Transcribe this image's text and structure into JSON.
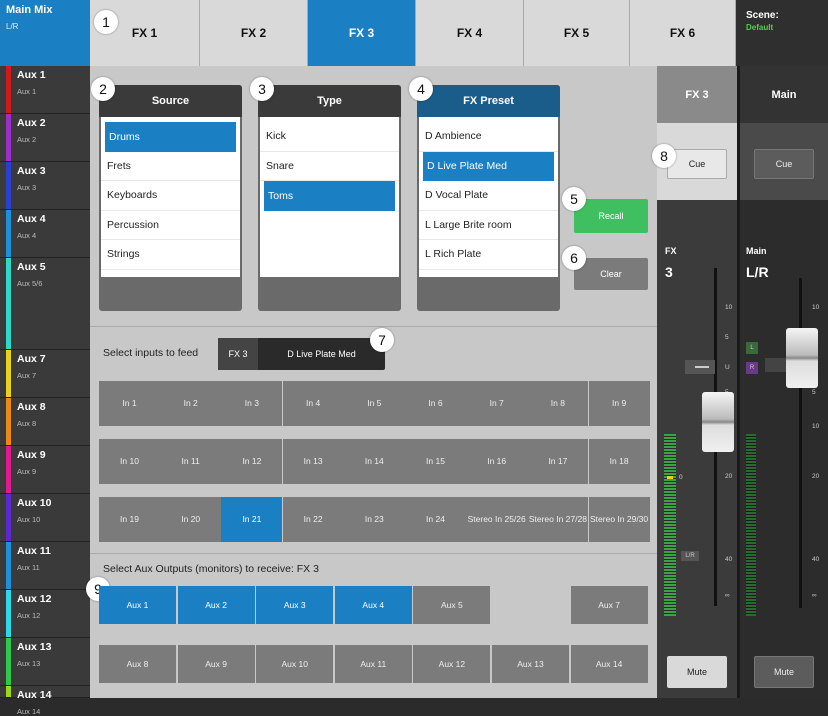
{
  "sidebar": {
    "top": {
      "title": "Main Mix",
      "sub": "L/R"
    },
    "items": [
      {
        "name": "Aux 1",
        "sub": "Aux 1",
        "color": "#d01a1a"
      },
      {
        "name": "Aux 2",
        "sub": "Aux 2",
        "color": "#9b2fc8"
      },
      {
        "name": "Aux 3",
        "sub": "Aux 3",
        "color": "#2a3fd0"
      },
      {
        "name": "Aux 4",
        "sub": "Aux 4",
        "color": "#1e8fd8"
      },
      {
        "name": "Aux 5",
        "sub": "Aux 5/6",
        "color": "#2ed8c8"
      },
      {
        "name": "Aux 7",
        "sub": "Aux 7",
        "color": "#e8d21a"
      },
      {
        "name": "Aux 8",
        "sub": "Aux 8",
        "color": "#e8891a"
      },
      {
        "name": "Aux 9",
        "sub": "Aux 9",
        "color": "#e01a8c"
      },
      {
        "name": "Aux 10",
        "sub": "Aux 10",
        "color": "#5a2ad0"
      },
      {
        "name": "Aux 11",
        "sub": "Aux 11",
        "color": "#1e8fd8"
      },
      {
        "name": "Aux 12",
        "sub": "Aux 12",
        "color": "#2ed8e8"
      },
      {
        "name": "Aux 13",
        "sub": "Aux 13",
        "color": "#2ec84a"
      },
      {
        "name": "Aux 14",
        "sub": "Aux 14",
        "color": "#9bd81a"
      }
    ]
  },
  "tabs": [
    "FX 1",
    "FX 2",
    "FX 3",
    "FX 4",
    "FX 5",
    "FX 6"
  ],
  "scene": {
    "label": "Scene:",
    "value": "Default"
  },
  "badges": [
    "1",
    "2",
    "3",
    "4",
    "5",
    "6",
    "7",
    "8",
    "9"
  ],
  "source": {
    "title": "Source",
    "items": [
      "Drums",
      "Frets",
      "Keyboards",
      "Percussion",
      "Strings"
    ]
  },
  "type": {
    "title": "Type",
    "items": [
      "Kick",
      "Snare",
      "Toms"
    ]
  },
  "preset": {
    "title": "FX Preset",
    "items": [
      "D Ambience",
      "D Live Plate Med",
      "D Vocal Plate",
      "L Large Brite room",
      "L Rich Plate"
    ]
  },
  "recall_label": "Recall",
  "clear_label": "Clear",
  "feed": {
    "label": "Select inputs to feed",
    "fx": "FX 3",
    "preset": "D Live Plate Med"
  },
  "inputs": [
    [
      "In 1",
      "In 2",
      "In 3",
      "In 4",
      "In 5",
      "In 6",
      "In 7",
      "In 8",
      "In 9"
    ],
    [
      "In 10",
      "In 11",
      "In 12",
      "In 13",
      "In 14",
      "In 15",
      "In 16",
      "In 17",
      "In 18"
    ],
    [
      "In 19",
      "In 20",
      "In 21",
      "In 22",
      "In 23",
      "In 24",
      "Stereo In 25/26",
      "Stereo In 27/28",
      "Stereo In 29/30"
    ]
  ],
  "aux_label": "Select Aux Outputs (monitors) to receive:  FX 3",
  "aux_row1": [
    "Aux 1",
    "Aux 2",
    "Aux 3",
    "Aux 4",
    "Aux 5",
    "",
    "Aux 7"
  ],
  "aux_row2": [
    "Aux 8",
    "Aux 9",
    "Aux 10",
    "Aux 11",
    "Aux 12",
    "Aux 13",
    "Aux 14"
  ],
  "fx_strip": {
    "title": "FX 3",
    "cue": "Cue",
    "label": "FX",
    "num": "3",
    "mute": "Mute",
    "ticks": [
      "10",
      "5",
      "U",
      "5",
      "10",
      "20",
      "40",
      "∞"
    ],
    "meter": "0",
    "lr": "L/R"
  },
  "main_strip": {
    "title": "Main",
    "cue": "Cue",
    "label": "Main",
    "sub": "L/R",
    "mute": "Mute",
    "ticks": [
      "10",
      "5",
      "U",
      "5",
      "10",
      "20",
      "40",
      "∞"
    ],
    "l": "L",
    "r": "R"
  },
  "colors": {
    "accent": "#1b7fc4",
    "recall": "#3fbf5f",
    "scene_value": "#4fd14f"
  }
}
